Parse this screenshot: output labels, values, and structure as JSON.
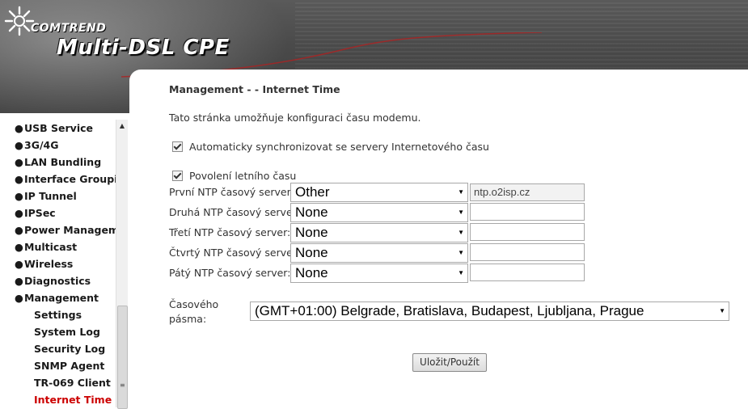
{
  "header": {
    "brand": "COMTREND",
    "product": "Multi-DSL CPE"
  },
  "sidebar": {
    "items": [
      {
        "label": "USB Service"
      },
      {
        "label": "3G/4G"
      },
      {
        "label": "LAN Bundling"
      },
      {
        "label": "Interface Grouping"
      },
      {
        "label": "IP Tunnel"
      },
      {
        "label": "IPSec"
      },
      {
        "label": "Power Management"
      },
      {
        "label": "Multicast"
      },
      {
        "label": "Wireless"
      },
      {
        "label": "Diagnostics"
      },
      {
        "label": "Management"
      }
    ],
    "subitems": [
      {
        "label": "Settings"
      },
      {
        "label": "System Log"
      },
      {
        "label": "Security Log"
      },
      {
        "label": "SNMP Agent"
      },
      {
        "label": "TR-069 Client"
      },
      {
        "label": "Internet Time"
      }
    ],
    "bullet": "●"
  },
  "main": {
    "title": "Management - - Internet Time",
    "description": "Tato stránka umožňuje konfiguraci času modemu.",
    "auto_sync_label": "Automaticky synchronizovat se servery Internetového času",
    "auto_sync_checked": true,
    "dst_label": "Povolení letního času",
    "dst_checked": true,
    "ntp_servers": [
      {
        "label": "První NTP časový server:",
        "selected": "Other",
        "value": "ntp.o2isp.cz"
      },
      {
        "label": "Druhá NTP časový server:",
        "selected": "None",
        "value": ""
      },
      {
        "label": "Třetí NTP časový server:",
        "selected": "None",
        "value": ""
      },
      {
        "label": "Čtvrtý NTP časový server:",
        "selected": "None",
        "value": ""
      },
      {
        "label": "Pátý NTP časový server:",
        "selected": "None",
        "value": ""
      }
    ],
    "timezone_label_line1": "Časového",
    "timezone_label_line2": "pásma:",
    "timezone_selected": "(GMT+01:00) Belgrade, Bratislava, Budapest, Ljubljana, Prague",
    "save_button": "Uložit/Použít"
  },
  "icons": {
    "dropdown_arrow": "▼",
    "scroll_up": "▲",
    "scroll_grip": "≡"
  },
  "colors": {
    "active_menu": "#cc0000",
    "header_bg": "#4a4a4a"
  }
}
